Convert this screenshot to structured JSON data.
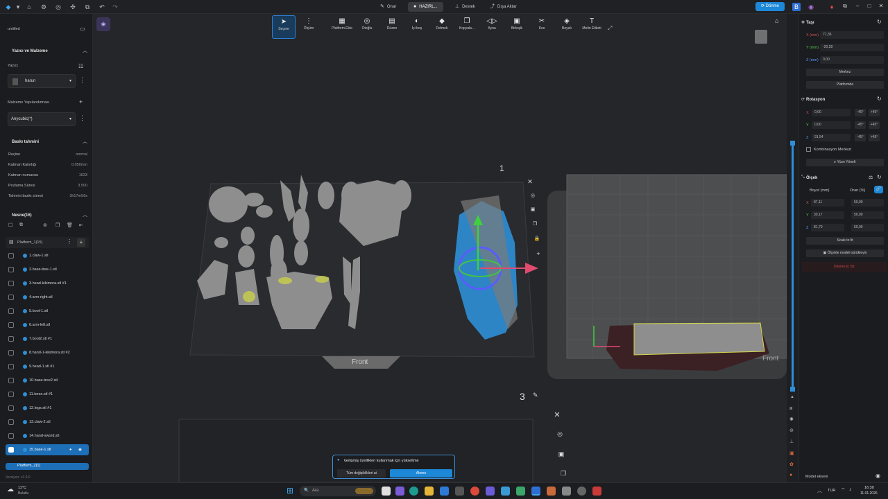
{
  "titlebar": {
    "tabs": [
      {
        "icon": "pencil-icon",
        "label": "Onar"
      },
      {
        "icon": "circle-icon",
        "label": "HAZIRL..."
      },
      {
        "icon": "support-icon",
        "label": "Destek"
      },
      {
        "icon": "export-icon",
        "label": "Dışa Aktar"
      }
    ],
    "update_label": "Dönme"
  },
  "left": {
    "file_name": "untitled",
    "printer_section": "Yazıcı ve Malzeme",
    "printer_label": "Yazıcı",
    "printer_value": "harun",
    "material_label": "Malzeme Yapılandırması",
    "material_value": "Anycubic(*)",
    "estimate_section": "Baskı tahmini",
    "estimates": [
      {
        "label": "Reçine",
        "value": "normal"
      },
      {
        "label": "Katman Kalınlığı",
        "value": "0.050mm"
      },
      {
        "label": "Katman numarası",
        "value": "1633"
      },
      {
        "label": "Pozlama Süresi",
        "value": "3.500"
      },
      {
        "label": "Tahmini baskı süresi",
        "value": "3h17m56s"
      }
    ],
    "objects_section": "Nesne(16)",
    "platform_label": "Platform_1(15)",
    "objects": [
      "1.claw-1.stl",
      "2.base-tree-1.stl",
      "3.head-kikimora.stl #1",
      "4.arm-right.stl",
      "5.boot-1.stl",
      "6.arm-left.stl",
      "7.boot2.stl #1",
      "8.hand-1-kikimora.stl #2",
      "9.head-1.stl #1",
      "10.base-tree2.stl",
      "11.torso.stl #1",
      "12.legs.stl #1",
      "13.claw-2.stl",
      "14.hand-sword.stl",
      "15.base-1.stl"
    ],
    "platform2_label": "Platform_2(1)",
    "version": "Versiyon: v1.0.0"
  },
  "toolbar": [
    {
      "icon": "cursor-icon",
      "label": "Seçme"
    },
    {
      "icon": "measure-icon",
      "label": "Ölçüm"
    },
    {
      "icon": "platform-icon",
      "label": "Platform Ekle"
    },
    {
      "icon": "orient-icon",
      "label": "Otoğlu"
    },
    {
      "icon": "layout-icon",
      "label": "Düzen"
    },
    {
      "icon": "hollow-icon",
      "label": "İçi boş"
    },
    {
      "icon": "drill-icon",
      "label": "Delmek"
    },
    {
      "icon": "copy-icon",
      "label": "Kopyala..."
    },
    {
      "icon": "mirror-icon",
      "label": "Ayna"
    },
    {
      "icon": "merge-icon",
      "label": "Birleşik"
    },
    {
      "icon": "cut-icon",
      "label": "Kes"
    },
    {
      "icon": "paint-icon",
      "label": "Boyalı"
    },
    {
      "icon": "text-icon",
      "label": "Metin Etiketi"
    }
  ],
  "viewport": {
    "front_label": "Front",
    "front_label_2": "Front",
    "number_1": "1",
    "number_3": "3"
  },
  "right": {
    "move_title": "Taşı",
    "move_x_label": "X (mm)",
    "move_x": "71,36",
    "move_y_label": "Y (mm)",
    "move_y": "-20,28",
    "move_z_label": "Z (mm)",
    "move_z": "0,00",
    "center_btn": "Merkez",
    "platform_btn": "Platformda",
    "rotate_title": "Rotasyon",
    "rot_x": "0,00",
    "rot_y": "0,00",
    "rot_z": "91,54",
    "minus45": "-45°",
    "plus45": "+45°",
    "combo_center": "Kombinasyon Merkezi",
    "face_btn": "Yüze Yönelt",
    "scale_title": "Ölçek",
    "size_label": "Boyut (mm)",
    "ratio_label": "Oran (%)",
    "sx": "87,11",
    "sy": "30,17",
    "sz": "81,70",
    "px": "50,00",
    "py": "50,00",
    "pz": "50,00",
    "scale_fit_btn": "Scale to fit",
    "scale_drag_btn": "Ölçekte modeli sürükleyin",
    "warning": "Dönme kl. 50",
    "model_label": "Model ekseni"
  },
  "notify": {
    "message": "Gelişmiş özellikleri kullanmak için yükseltme",
    "btn_all": "Tüm değişiklikleri at",
    "btn_upgrade": "Abone"
  },
  "taskbar": {
    "weather_temp": "11°C",
    "weather_text": "Bulutlu",
    "search_placeholder": "Ara",
    "lang": "TUR",
    "time": "16:30",
    "date": "11.01.2026"
  },
  "colors": {
    "accent": "#1d88d8",
    "selected_model": "#2f8fd6",
    "highlight_yellow": "#d4d84a"
  }
}
